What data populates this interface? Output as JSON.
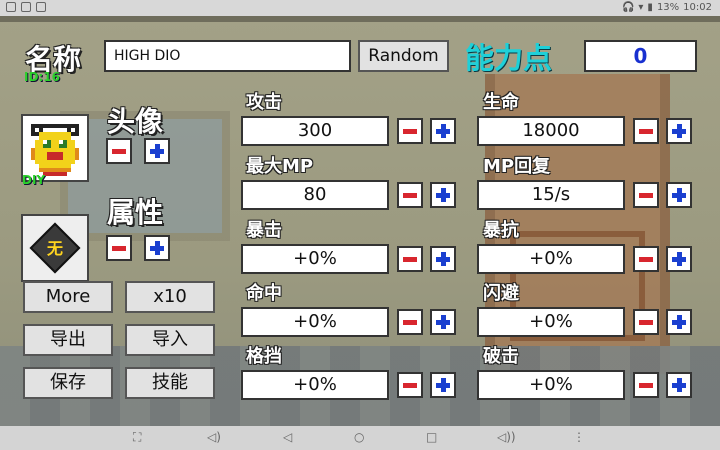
{
  "status_bar": {
    "battery": "13%",
    "time": "10:02"
  },
  "header": {
    "name_label": "名称",
    "id_label": "ID:16",
    "name_value": "HIGH DIO",
    "random_label": "Random",
    "points_label": "能力点",
    "points_value": "0"
  },
  "avatar": {
    "label": "头像",
    "diy_label": "DIY"
  },
  "attribute": {
    "label": "属性",
    "value": "无"
  },
  "buttons": {
    "more": "More",
    "x10": "x10",
    "export": "导出",
    "import": "导入",
    "save": "保存",
    "skills": "技能"
  },
  "stats": {
    "attack": {
      "label": "攻击",
      "value": "300"
    },
    "hp": {
      "label": "生命",
      "value": "18000"
    },
    "max_mp": {
      "label": "最大MP",
      "value": "80"
    },
    "mp_regen": {
      "label": "MP回复",
      "value": "15/s"
    },
    "crit": {
      "label": "暴击",
      "value": "+0%"
    },
    "crit_res": {
      "label": "暴抗",
      "value": "+0%"
    },
    "hit": {
      "label": "命中",
      "value": "+0%"
    },
    "dodge": {
      "label": "闪避",
      "value": "+0%"
    },
    "block": {
      "label": "格挡",
      "value": "+0%"
    },
    "pierce": {
      "label": "破击",
      "value": "+0%"
    }
  },
  "colors": {
    "points_label": "#1fd0d8",
    "points_value": "#1830d0",
    "minus": "#d8262e",
    "plus": "#1a3fd0",
    "id_text": "#2bd12b"
  },
  "icons": [
    "voicemail-icon",
    "mail-icon",
    "image-icon",
    "headphones-icon",
    "wifi-icon",
    "battery-icon",
    "screenshot-icon",
    "volume-down-icon",
    "back-icon",
    "home-icon",
    "recents-icon",
    "volume-up-icon",
    "menu-icon"
  ]
}
